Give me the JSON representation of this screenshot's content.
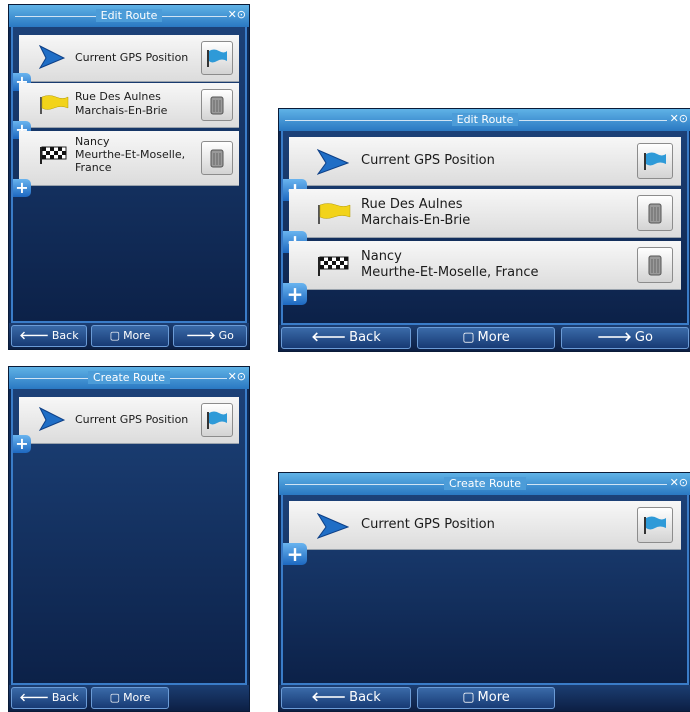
{
  "screen1": {
    "title": "Edit Route",
    "gps_status": "✕⊙",
    "rows": [
      {
        "text1": "Current GPS Position",
        "text2": ""
      },
      {
        "text1": "Rue Des Aulnes",
        "text2": "Marchais-En-Brie"
      },
      {
        "text1": "Nancy",
        "text2": "Meurthe-Et-Moselle,",
        "text3": "France"
      }
    ],
    "buttons": {
      "back": "Back",
      "more": "More",
      "go": "Go"
    }
  },
  "screen2": {
    "title": "Edit Route",
    "gps_status": "✕⊙",
    "rows": [
      {
        "text1": "Current GPS Position",
        "text2": ""
      },
      {
        "text1": "Rue Des Aulnes",
        "text2": "Marchais-En-Brie"
      },
      {
        "text1": "Nancy",
        "text2": "Meurthe-Et-Moselle, France"
      }
    ],
    "buttons": {
      "back": "Back",
      "more": "More",
      "go": "Go"
    }
  },
  "screen3": {
    "title": "Create Route",
    "gps_status": "✕⊙",
    "rows": [
      {
        "text1": "Current GPS Position"
      }
    ],
    "buttons": {
      "back": "Back",
      "more": "More"
    }
  },
  "screen4": {
    "title": "Create Route",
    "gps_status": "✕⊙",
    "rows": [
      {
        "text1": "Current GPS Position"
      }
    ],
    "buttons": {
      "back": "Back",
      "more": "More"
    }
  },
  "icons": {
    "start": "start-arrow-icon",
    "waypoint": "yellow-flag-icon",
    "destination": "checkered-flag-icon",
    "set_start": "blue-flag-icon",
    "delete": "trash-icon",
    "add": "plus-icon"
  },
  "colors": {
    "title_bar": "#2a78c2",
    "panel": "#0f2a55",
    "row": "#e8e8e8",
    "plus": "#1d68c0",
    "flag_blue": "#2e9ad8",
    "flag_yellow": "#f2d31a"
  }
}
